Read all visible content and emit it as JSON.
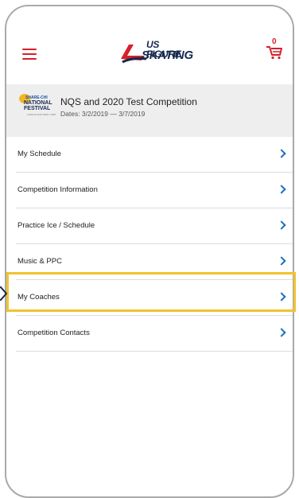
{
  "header": {
    "menu_icon": "hamburger-menu-icon",
    "logo_text_line1": "US FIGURE",
    "logo_text_line2": "SKATING",
    "cart_icon": "cart-icon",
    "cart_count": "0"
  },
  "event": {
    "logo_line1": "SHARE-CHI",
    "logo_line2": "NATIONAL",
    "logo_line3": "FESTIVAL",
    "logo_line4": "LAKE PLACID NEW YORK",
    "title": "NQS and 2020 Test Competition",
    "dates": "Dates: 3/2/2019 — 3/7/2019"
  },
  "menu": {
    "items": [
      {
        "label": "My Schedule"
      },
      {
        "label": "Competition Information"
      },
      {
        "label": "Practice Ice / Schedule"
      },
      {
        "label": "Music & PPC"
      },
      {
        "label": "My Coaches"
      },
      {
        "label": "Competition Contacts"
      }
    ]
  },
  "colors": {
    "accent_red": "#d6202a",
    "navy": "#14294f",
    "chevron_blue": "#1a6fc0",
    "highlight_yellow": "#f0c32f",
    "event_bg": "#eeeeee"
  }
}
